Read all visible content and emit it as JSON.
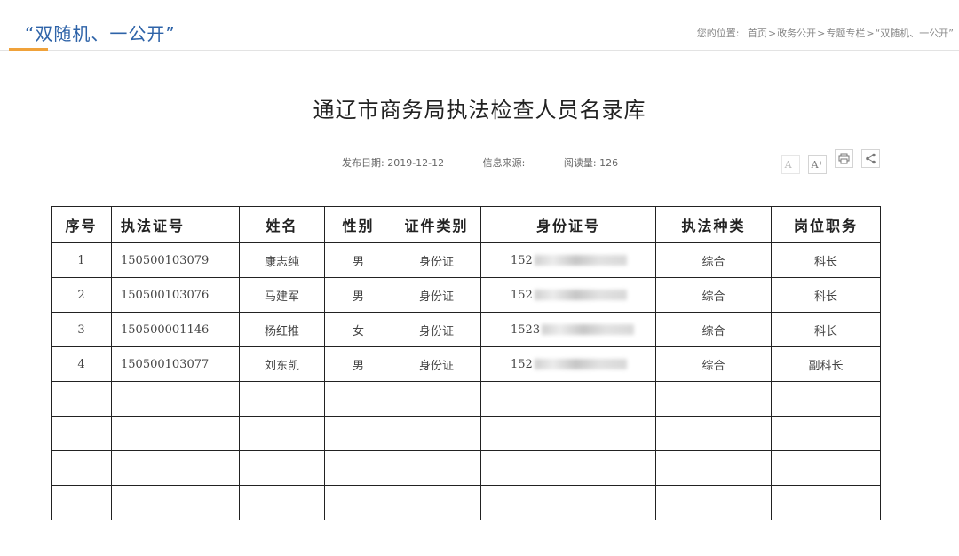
{
  "header": {
    "section_title": "“双随机、一公开”",
    "breadcrumb": {
      "label": "您的位置:",
      "items": [
        "首页",
        "政务公开",
        "专题专栏",
        "“双随机、一公开”"
      ],
      "separator": ">"
    }
  },
  "article": {
    "title": "通辽市商务局执法检查人员名录库",
    "meta": {
      "publish_label": "发布日期:",
      "publish_date": "2019-12-12",
      "source_label": "信息来源:",
      "source": "",
      "views_label": "阅读量:",
      "views": "126"
    },
    "tools": [
      {
        "name": "font-decrease-icon",
        "glyph": "A⁻"
      },
      {
        "name": "font-increase-icon",
        "glyph": "A⁺"
      },
      {
        "name": "print-icon",
        "glyph": ""
      },
      {
        "name": "share-icon",
        "glyph": ""
      }
    ]
  },
  "table": {
    "columns": [
      "序号",
      "执法证号",
      "姓名",
      "性别",
      "证件类别",
      "身份证号",
      "执法种类",
      "岗位职务"
    ],
    "rows": [
      [
        "1",
        "150500103079",
        "康志纯",
        "男",
        "身份证",
        "152",
        "综合",
        "科长"
      ],
      [
        "2",
        "150500103076",
        "马建军",
        "男",
        "身份证",
        "152",
        "综合",
        "科长"
      ],
      [
        "3",
        "150500001146",
        "杨红推",
        "女",
        "身份证",
        "1523",
        "综合",
        "科长"
      ],
      [
        "4",
        "150500103077",
        "刘东凯",
        "男",
        "身份证",
        "152",
        "综合",
        "副科长"
      ],
      [
        "",
        "",
        "",
        "",
        "",
        "",
        "",
        ""
      ],
      [
        "",
        "",
        "",
        "",
        "",
        "",
        "",
        ""
      ],
      [
        "",
        "",
        "",
        "",
        "",
        "",
        "",
        ""
      ],
      [
        "",
        "",
        "",
        "",
        "",
        "",
        "",
        ""
      ]
    ]
  },
  "colors": {
    "section_title": "#2e63a8",
    "accent_underline": "#f0a23a",
    "table_border": "#222222"
  }
}
